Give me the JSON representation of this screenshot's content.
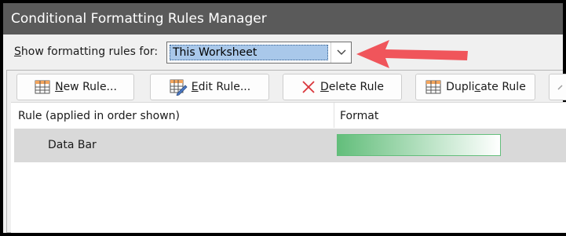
{
  "window": {
    "title": "Conditional Formatting Rules Manager"
  },
  "scope": {
    "label_prefix": "S",
    "label_rest": "how formatting rules for:",
    "selected": "This Worksheet"
  },
  "toolbar": {
    "new_rule": {
      "mnemonic": "N",
      "rest": "ew Rule...",
      "icon": "new-rule-icon"
    },
    "edit_rule": {
      "mnemonic": "E",
      "rest": "dit Rule...",
      "icon": "edit-rule-icon"
    },
    "delete_rule": {
      "mnemonic": "D",
      "rest": "elete Rule",
      "icon": "delete-x-icon"
    },
    "duplicate_rule": {
      "before": "Dupli",
      "mnemonic": "c",
      "rest": "ate Rule",
      "icon": "duplicate-rule-icon"
    },
    "move_up": {
      "icon": "chevron-up-icon"
    }
  },
  "list": {
    "columns": [
      "Rule (applied in order shown)",
      "Format"
    ],
    "rows": [
      {
        "rule": "Data Bar",
        "format": "data-bar-gradient"
      }
    ]
  },
  "colors": {
    "titlebar": "#5a5a5a",
    "selection": "#a9c8ea",
    "row_selected": "#d9d9d9",
    "databar_start": "#63be7b",
    "databar_end": "#ffffff",
    "annotation_arrow": "#f0555b"
  }
}
